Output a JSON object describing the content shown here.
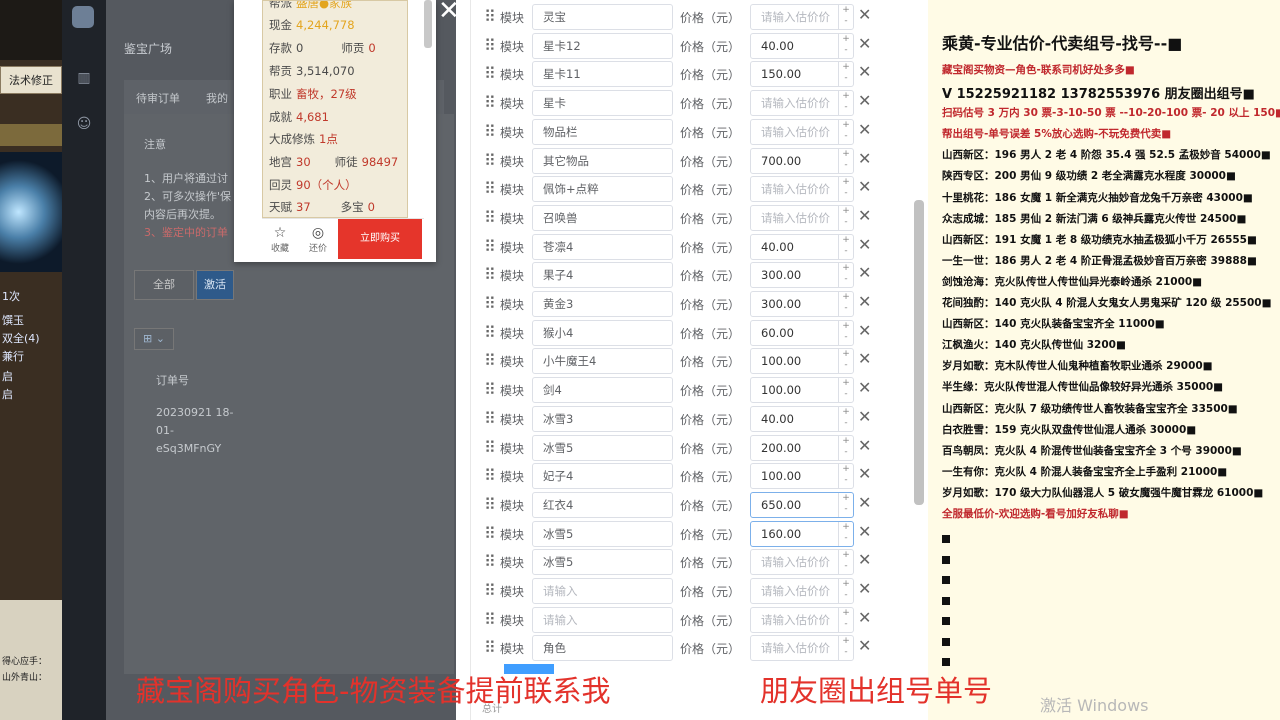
{
  "game": {
    "tab_label": "法术修正",
    "lines": [
      "1次",
      "馔玉",
      "双全(4)",
      "兼行",
      "启",
      "启"
    ],
    "bottom_lines": [
      "得心应手：",
      "山外青山："
    ]
  },
  "admin": {
    "breadcrumb": "鉴宝广场",
    "tabs": [
      "待审订单",
      "我的"
    ],
    "notice_title": "注意",
    "notice_lines": [
      "1、用户将通过讨",
      "2、可多次操作'保",
      "内容后再次提。",
      "3、鉴定中的订单"
    ],
    "filter_all": "全部",
    "filter_active": "激活",
    "grid_label": "⊞ ⌄",
    "order_col": "订单号",
    "order_value_lines": [
      "20230921 18-",
      "01-",
      "eSq3MFnGY"
    ]
  },
  "product": {
    "stats": [
      {
        "label": "帮派",
        "value": "盛唐●家族",
        "yellow": true
      },
      {
        "label": "现金",
        "value": "4,244,778",
        "yellow": true
      },
      {
        "label": "存款",
        "value": "0",
        "extra_label": "师贡",
        "extra_value": "0",
        "grey": true
      },
      {
        "label": "帮贡",
        "value": "3,514,070",
        "grey": true
      },
      {
        "label": "职业",
        "value": "畜牧，27级"
      },
      {
        "label": "成就",
        "value": "4,681"
      },
      {
        "label": "大成修炼",
        "value": "1点"
      },
      {
        "label": "地宫",
        "value": "30",
        "extra_label": "师徒",
        "extra_value": "98497"
      },
      {
        "label": "回灵",
        "value": "90（个人）"
      },
      {
        "label": "天赋",
        "value": "37",
        "extra_label": "多宝",
        "extra_value": "0"
      }
    ],
    "fav_label": "收藏",
    "bargain_label": "还价",
    "buy_label": "立即购买"
  },
  "form": {
    "module_label": "模块",
    "price_label": "价格（元）",
    "price_placeholder": "请输入估价价",
    "name_placeholder": "请输入",
    "rows": [
      {
        "name": "灵宝",
        "price": ""
      },
      {
        "name": "星卡12",
        "price": "40.00"
      },
      {
        "name": "星卡11",
        "price": "150.00"
      },
      {
        "name": "星卡",
        "price": ""
      },
      {
        "name": "物品栏",
        "price": ""
      },
      {
        "name": "其它物品",
        "price": "700.00"
      },
      {
        "name": "佩饰+点粹",
        "price": ""
      },
      {
        "name": "召唤兽",
        "price": ""
      },
      {
        "name": "苍凛4",
        "price": "40.00"
      },
      {
        "name": "果子4",
        "price": "300.00"
      },
      {
        "name": "黄金3",
        "price": "300.00"
      },
      {
        "name": "猴小4",
        "price": "60.00"
      },
      {
        "name": "小牛魔王4",
        "price": "100.00"
      },
      {
        "name": "剑4",
        "price": "100.00"
      },
      {
        "name": "冰雪3",
        "price": "40.00"
      },
      {
        "name": "冰雪5",
        "price": "200.00"
      },
      {
        "name": "妃子4",
        "price": "100.00"
      },
      {
        "name": "红衣4",
        "price": "650.00"
      },
      {
        "name": "冰雪5",
        "price": "160.00"
      },
      {
        "name": "冰雪5",
        "price": ""
      },
      {
        "name": "",
        "price": ""
      },
      {
        "name": "",
        "price": ""
      },
      {
        "name": "角色",
        "price": ""
      }
    ],
    "footer": "总计"
  },
  "notice": {
    "title": "乘黄-专业估价-代卖组号-找号--■",
    "lines": [
      {
        "text": "藏宝阁买物资—角色-联系司机好处多多■",
        "red": true
      },
      {
        "text": "V 15225921182   13782553976 朋友圈出组号■",
        "big": true
      },
      {
        "text": "扫码估号 3 万内 30 票-3-10-50 票  --10-20-100 票- 20 以上 150■",
        "red": true
      },
      {
        "text": "帮出组号-单号误差 5%放心选购-不玩免费代卖■",
        "red": true
      },
      {
        "text": "山西新区：196 男人 2 老 4 阶怨 35.4 强 52.5 孟极妙音 54000■"
      },
      {
        "text": "陕西专区：200 男仙 9 级功绩 2 老全满露克水程度 30000■"
      },
      {
        "text": "十里桃花：186 女魔 1 新全满克火抽妙音龙兔千万亲密 43000■"
      },
      {
        "text": "众志成城：185 男仙 2 新法门满 6 级神兵露克火传世 24500■"
      },
      {
        "text": "山西新区：191 女魔 1 老 8 级功绩克水抽孟极狐小千万 26555■"
      },
      {
        "text": "一生一世：186 男人 2 老 4 阶正骨混孟极妙音百万亲密 39888■"
      },
      {
        "text": "剑蚀沧海：克火队传世人传世仙异光泰岭通杀 21000■"
      },
      {
        "text": "花间独酌：140 克火队 4 阶混人女鬼女人男鬼采矿 120 级 25500■"
      },
      {
        "text": "山西新区：140 克火队装备宝宝齐全 11000■"
      },
      {
        "text": "江枫渔火：140 克火队传世仙 3200■"
      },
      {
        "text": "岁月如歌：克木队传世人仙鬼种植畜牧职业通杀 29000■"
      },
      {
        "text": "半生缘：克火队传世混人传世仙品像较好异光通杀 35000■"
      },
      {
        "text": "山西新区：克火队 7 级功绩传世人畜牧装备宝宝齐全 33500■"
      },
      {
        "text": "白衣胜雪：159 克火队双盘传世仙混人通杀 30000■"
      },
      {
        "text": "百鸟朝凤：克火队 4 阶混传世仙装备宝宝齐全 3 个号 39000■"
      },
      {
        "text": "一生有你：克火队 4 阶混人装备宝宝齐全上手盈利 21000■"
      },
      {
        "text": "岁月如歌：170 级大力队仙器混人 5 破女魔强牛魔甘霖龙 61000■"
      },
      {
        "text": "全服最低价-欢迎选购-看号加好友私聊■",
        "red": true
      }
    ],
    "watermark": "激活 Windows"
  },
  "caption": {
    "left": "藏宝阁购买角色-物资装备提前联系我",
    "right": "朋友圈出组号单号"
  },
  "colors": {
    "accent_red": "#e3322b",
    "primary_blue": "#409eff",
    "notice_bg": "#fffbe6"
  }
}
